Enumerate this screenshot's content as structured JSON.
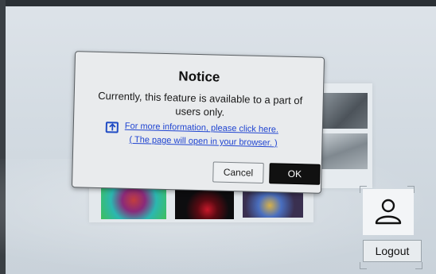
{
  "dialog": {
    "title": "Notice",
    "message": "Currently, this feature is available to a part of users only.",
    "link_text": "For more information, please click here.",
    "link_note": "( The page will open in your browser. )",
    "cancel_label": "Cancel",
    "ok_label": "OK"
  },
  "account": {
    "avatar_icon": "user-icon",
    "logout_label": "Logout"
  },
  "colors": {
    "dialog_background": "#e9ebed",
    "link": "#1f44d1",
    "ok_button": "#111111"
  }
}
